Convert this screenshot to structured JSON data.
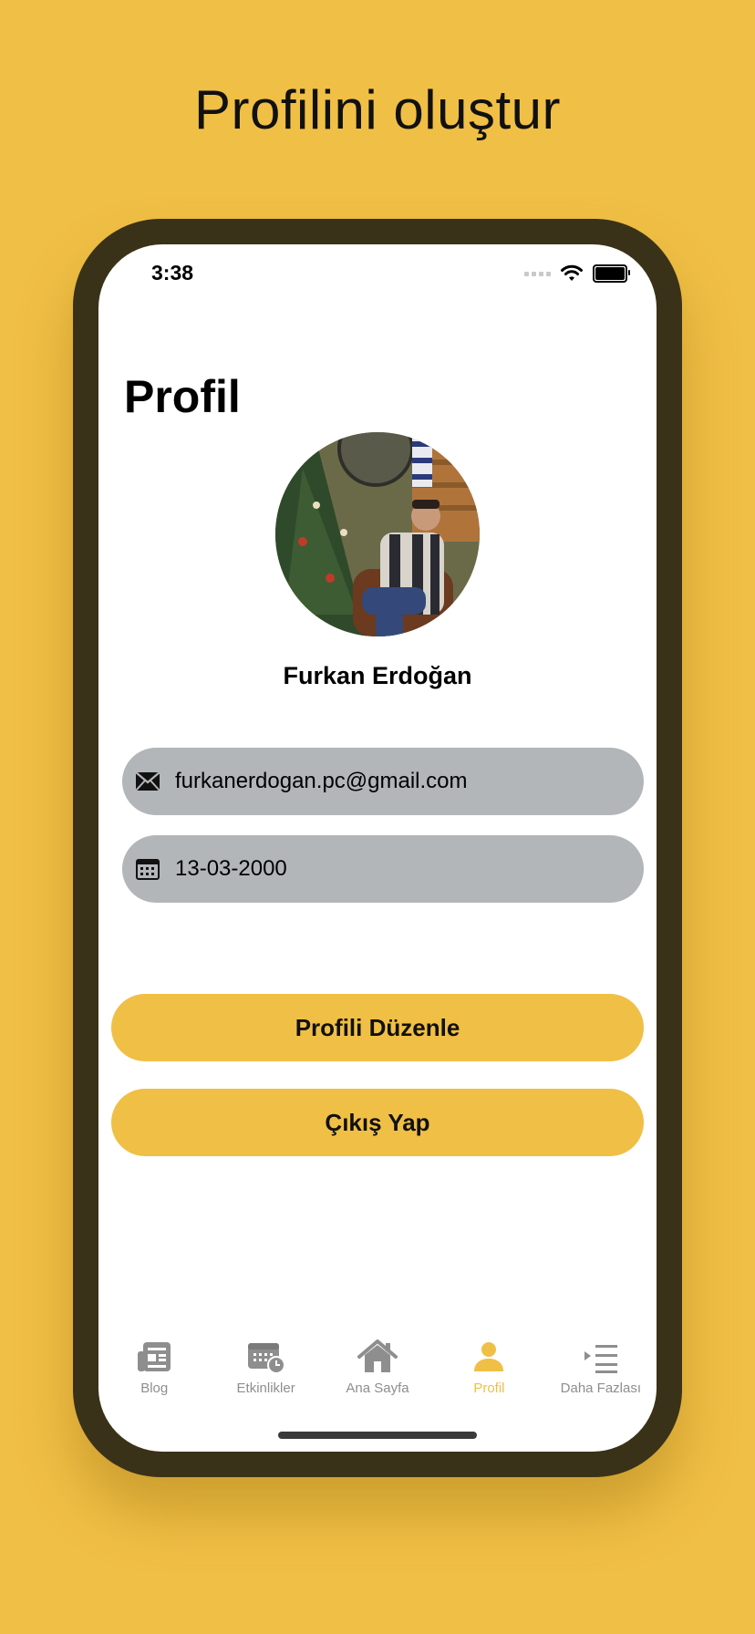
{
  "promo": {
    "title": "Profilini oluştur"
  },
  "status_bar": {
    "time": "3:38"
  },
  "page": {
    "title": "Profil"
  },
  "profile": {
    "name": "Furkan Erdoğan",
    "email": "furkanerdogan.pc@gmail.com",
    "birth_date": "13-03-2000"
  },
  "actions": {
    "edit_label": "Profili Düzenle",
    "logout_label": "Çıkış Yap"
  },
  "tabs": [
    {
      "label": "Blog",
      "icon": "newspaper-icon"
    },
    {
      "label": "Etkinlikler",
      "icon": "calendar-clock-icon"
    },
    {
      "label": "Ana Sayfa",
      "icon": "house-icon"
    },
    {
      "label": "Profil",
      "icon": "person-icon",
      "active": true
    },
    {
      "label": "Daha Fazlası",
      "icon": "list-more-icon"
    }
  ],
  "colors": {
    "background": "#F0BF45",
    "accent": "#F0BF45",
    "field": "#B2B6B8",
    "frame": "#3A3218",
    "inactive_tab": "#8E8E8E"
  }
}
